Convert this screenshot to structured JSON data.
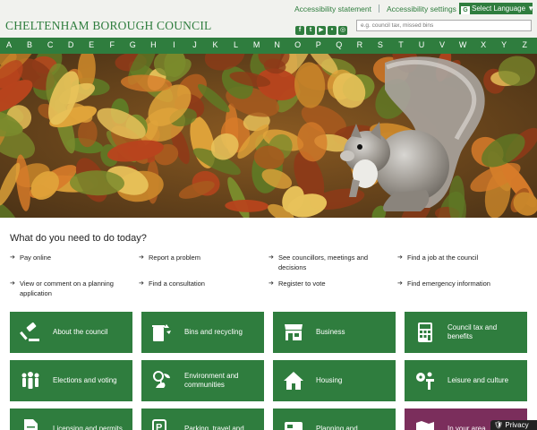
{
  "header": {
    "title": "CHELTENHAM BOROUGH COUNCIL",
    "links": [
      "Accessibility statement",
      "Accessibility settings"
    ],
    "language_label": "Select Language",
    "search_placeholder": "e.g. council tax, missed bins",
    "social_icons": [
      "facebook-icon",
      "twitter-icon",
      "youtube-icon",
      "flickr-icon",
      "instagram-icon"
    ]
  },
  "az": [
    "A",
    "B",
    "C",
    "D",
    "E",
    "F",
    "G",
    "H",
    "I",
    "J",
    "K",
    "L",
    "M",
    "N",
    "O",
    "P",
    "Q",
    "R",
    "S",
    "T",
    "U",
    "V",
    "W",
    "X",
    "Y",
    "Z"
  ],
  "tasks": {
    "title": "What do you need to do today?",
    "items": [
      "Pay online",
      "Report a problem",
      "See councillors, meetings and decisions",
      "Find a job at the council",
      "View or comment on a planning application",
      "Find a consultation",
      "Register to vote",
      "Find emergency information"
    ]
  },
  "tiles": [
    {
      "label": "About the council",
      "icon": "gavel-icon"
    },
    {
      "label": "Bins and recycling",
      "icon": "recycle-bin-icon"
    },
    {
      "label": "Business",
      "icon": "shop-icon"
    },
    {
      "label": "Council tax and benefits",
      "icon": "calculator-icon"
    },
    {
      "label": "Elections and voting",
      "icon": "people-icon"
    },
    {
      "label": "Environment and communities",
      "icon": "environment-icon"
    },
    {
      "label": "Housing",
      "icon": "house-icon"
    },
    {
      "label": "Leisure and culture",
      "icon": "leisure-icon"
    },
    {
      "label": "Licensing and permits",
      "icon": "document-icon"
    },
    {
      "label": "Parking, travel and",
      "icon": "parking-icon"
    },
    {
      "label": "Planning and",
      "icon": "planning-icon"
    },
    {
      "label": "In your area",
      "icon": "map-icon"
    }
  ],
  "colors": {
    "brand": "#2f7d3e",
    "tile": "#2f7d3e",
    "area_tile": "#7b2e5c"
  },
  "privacy_label": "Privacy"
}
